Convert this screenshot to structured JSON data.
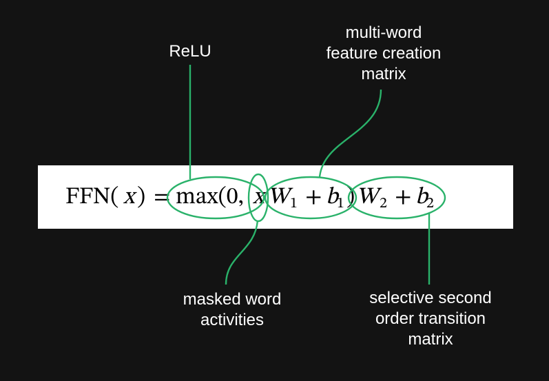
{
  "labels": {
    "relu": "ReLU",
    "multi": "multi-word\nfeature creation\nmatrix",
    "masked": "masked word\nactivities",
    "selective": "selective second\norder transition\nmatrix"
  },
  "equation": {
    "ffn": "FFN(",
    "x1": "x",
    "close1": ")",
    "eq": "=",
    "max": "max(0,",
    "x2": "x",
    "W1": "W",
    "sub1": "1",
    "plus1": "+",
    "b1": "b",
    "sub1b": "1",
    "close2": ")",
    "W2": "W",
    "sub2": "2",
    "plus2": "+",
    "b2": "b",
    "sub2b": "2"
  }
}
